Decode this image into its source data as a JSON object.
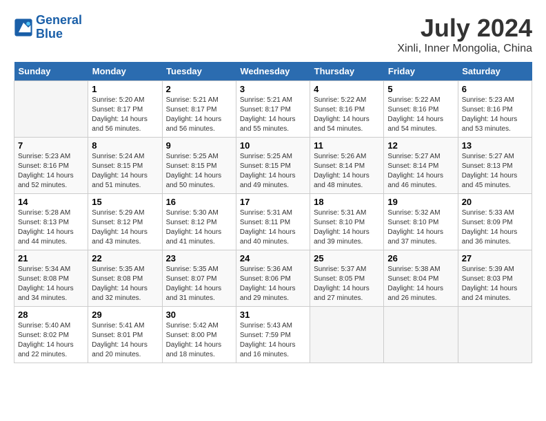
{
  "header": {
    "logo_line1": "General",
    "logo_line2": "Blue",
    "month_title": "July 2024",
    "location": "Xinli, Inner Mongolia, China"
  },
  "days_of_week": [
    "Sunday",
    "Monday",
    "Tuesday",
    "Wednesday",
    "Thursday",
    "Friday",
    "Saturday"
  ],
  "weeks": [
    [
      {
        "day": "",
        "info": ""
      },
      {
        "day": "1",
        "info": "Sunrise: 5:20 AM\nSunset: 8:17 PM\nDaylight: 14 hours\nand 56 minutes."
      },
      {
        "day": "2",
        "info": "Sunrise: 5:21 AM\nSunset: 8:17 PM\nDaylight: 14 hours\nand 56 minutes."
      },
      {
        "day": "3",
        "info": "Sunrise: 5:21 AM\nSunset: 8:17 PM\nDaylight: 14 hours\nand 55 minutes."
      },
      {
        "day": "4",
        "info": "Sunrise: 5:22 AM\nSunset: 8:16 PM\nDaylight: 14 hours\nand 54 minutes."
      },
      {
        "day": "5",
        "info": "Sunrise: 5:22 AM\nSunset: 8:16 PM\nDaylight: 14 hours\nand 54 minutes."
      },
      {
        "day": "6",
        "info": "Sunrise: 5:23 AM\nSunset: 8:16 PM\nDaylight: 14 hours\nand 53 minutes."
      }
    ],
    [
      {
        "day": "7",
        "info": "Sunrise: 5:23 AM\nSunset: 8:16 PM\nDaylight: 14 hours\nand 52 minutes."
      },
      {
        "day": "8",
        "info": "Sunrise: 5:24 AM\nSunset: 8:15 PM\nDaylight: 14 hours\nand 51 minutes."
      },
      {
        "day": "9",
        "info": "Sunrise: 5:25 AM\nSunset: 8:15 PM\nDaylight: 14 hours\nand 50 minutes."
      },
      {
        "day": "10",
        "info": "Sunrise: 5:25 AM\nSunset: 8:15 PM\nDaylight: 14 hours\nand 49 minutes."
      },
      {
        "day": "11",
        "info": "Sunrise: 5:26 AM\nSunset: 8:14 PM\nDaylight: 14 hours\nand 48 minutes."
      },
      {
        "day": "12",
        "info": "Sunrise: 5:27 AM\nSunset: 8:14 PM\nDaylight: 14 hours\nand 46 minutes."
      },
      {
        "day": "13",
        "info": "Sunrise: 5:27 AM\nSunset: 8:13 PM\nDaylight: 14 hours\nand 45 minutes."
      }
    ],
    [
      {
        "day": "14",
        "info": "Sunrise: 5:28 AM\nSunset: 8:13 PM\nDaylight: 14 hours\nand 44 minutes."
      },
      {
        "day": "15",
        "info": "Sunrise: 5:29 AM\nSunset: 8:12 PM\nDaylight: 14 hours\nand 43 minutes."
      },
      {
        "day": "16",
        "info": "Sunrise: 5:30 AM\nSunset: 8:12 PM\nDaylight: 14 hours\nand 41 minutes."
      },
      {
        "day": "17",
        "info": "Sunrise: 5:31 AM\nSunset: 8:11 PM\nDaylight: 14 hours\nand 40 minutes."
      },
      {
        "day": "18",
        "info": "Sunrise: 5:31 AM\nSunset: 8:10 PM\nDaylight: 14 hours\nand 39 minutes."
      },
      {
        "day": "19",
        "info": "Sunrise: 5:32 AM\nSunset: 8:10 PM\nDaylight: 14 hours\nand 37 minutes."
      },
      {
        "day": "20",
        "info": "Sunrise: 5:33 AM\nSunset: 8:09 PM\nDaylight: 14 hours\nand 36 minutes."
      }
    ],
    [
      {
        "day": "21",
        "info": "Sunrise: 5:34 AM\nSunset: 8:08 PM\nDaylight: 14 hours\nand 34 minutes."
      },
      {
        "day": "22",
        "info": "Sunrise: 5:35 AM\nSunset: 8:08 PM\nDaylight: 14 hours\nand 32 minutes."
      },
      {
        "day": "23",
        "info": "Sunrise: 5:35 AM\nSunset: 8:07 PM\nDaylight: 14 hours\nand 31 minutes."
      },
      {
        "day": "24",
        "info": "Sunrise: 5:36 AM\nSunset: 8:06 PM\nDaylight: 14 hours\nand 29 minutes."
      },
      {
        "day": "25",
        "info": "Sunrise: 5:37 AM\nSunset: 8:05 PM\nDaylight: 14 hours\nand 27 minutes."
      },
      {
        "day": "26",
        "info": "Sunrise: 5:38 AM\nSunset: 8:04 PM\nDaylight: 14 hours\nand 26 minutes."
      },
      {
        "day": "27",
        "info": "Sunrise: 5:39 AM\nSunset: 8:03 PM\nDaylight: 14 hours\nand 24 minutes."
      }
    ],
    [
      {
        "day": "28",
        "info": "Sunrise: 5:40 AM\nSunset: 8:02 PM\nDaylight: 14 hours\nand 22 minutes."
      },
      {
        "day": "29",
        "info": "Sunrise: 5:41 AM\nSunset: 8:01 PM\nDaylight: 14 hours\nand 20 minutes."
      },
      {
        "day": "30",
        "info": "Sunrise: 5:42 AM\nSunset: 8:00 PM\nDaylight: 14 hours\nand 18 minutes."
      },
      {
        "day": "31",
        "info": "Sunrise: 5:43 AM\nSunset: 7:59 PM\nDaylight: 14 hours\nand 16 minutes."
      },
      {
        "day": "",
        "info": ""
      },
      {
        "day": "",
        "info": ""
      },
      {
        "day": "",
        "info": ""
      }
    ]
  ]
}
